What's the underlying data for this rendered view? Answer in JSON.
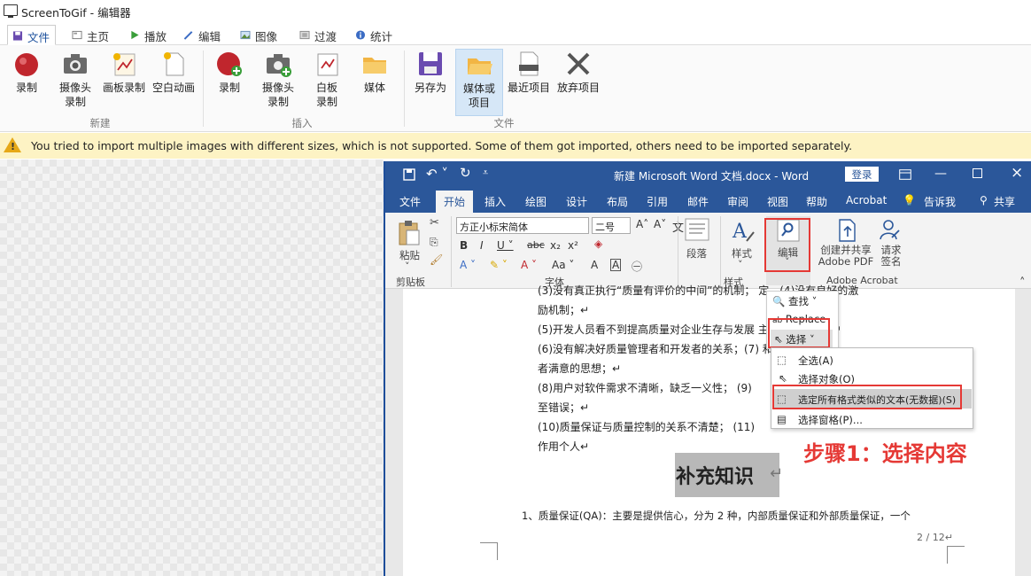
{
  "window": {
    "title": "ScreenToGif - 编辑器"
  },
  "tabs": [
    {
      "label": "文件",
      "active": true
    },
    {
      "label": "主页"
    },
    {
      "label": "播放"
    },
    {
      "label": "编辑"
    },
    {
      "label": "图像"
    },
    {
      "label": "过渡"
    },
    {
      "label": "统计"
    }
  ],
  "ribbon": {
    "new_group": {
      "label": "新建",
      "buttons": [
        {
          "label": "录制",
          "icon": "record-icon"
        },
        {
          "label": "摄像头\n录制",
          "icon": "camera-icon"
        },
        {
          "label": "画板录制",
          "icon": "board-icon"
        },
        {
          "label": "空白动画",
          "icon": "blank-page-icon"
        }
      ]
    },
    "insert_group": {
      "label": "插入",
      "buttons": [
        {
          "label": "录制",
          "icon": "record-add-icon"
        },
        {
          "label": "摄像头\n录制",
          "icon": "camera-add-icon"
        },
        {
          "label": "白板\n录制",
          "icon": "whiteboard-icon"
        },
        {
          "label": "媒体",
          "icon": "folder-icon"
        }
      ]
    },
    "file_group": {
      "label": "文件",
      "buttons": [
        {
          "label": "另存为",
          "icon": "save-icon"
        },
        {
          "label": "媒体或\n项目",
          "icon": "open-folder-icon",
          "selected": true
        },
        {
          "label": "最近项目",
          "icon": "recent-icon"
        },
        {
          "label": "放弃项目",
          "icon": "discard-icon"
        }
      ]
    }
  },
  "warning": {
    "text": "You tried to import multiple images with different sizes, which is not supported. Some of them got imported, others need to be imported separately."
  },
  "word": {
    "title": "新建 Microsoft Word 文档.docx  -  Word",
    "login_label": "登录",
    "tabs": [
      "文件",
      "开始",
      "插入",
      "绘图",
      "设计",
      "布局",
      "引用",
      "邮件",
      "审阅",
      "视图",
      "帮助",
      "Acrobat"
    ],
    "active_tab": "开始",
    "tell_me": "告诉我",
    "share": "共享",
    "ribbon": {
      "paste": "粘贴",
      "clipboard": "剪贴板",
      "font_name": "方正小标宋简体",
      "font_size": "二号",
      "font_group": "字体",
      "paragraph": "段落",
      "styles": "样式",
      "styles_group": "样式",
      "editing": "编辑",
      "create_pdf": "创建并共享\nAdobe PDF",
      "request_sign": "请求\n签名",
      "acrobat_group": "Adobe Acrobat"
    },
    "document": {
      "lines": [
        "(3)没有真正执行“质量有评价的中间”的机制；       定，(4)没有良好的激",
        "励机制；↵",
        "(5)开发人员看不到提高质量对企业生存与发展         主人翁责任感；↵",
        "(6)没有解决好质量管理者和开发者的关系；(7)         和高手会大作用",
        "者满意的思想；↵",
        "(8)用户对软件需求不清晰，缺乏一义性；     (9)",
        "至错误；↵",
        "(10)质量保证与质量控制的关系不清楚；       (11)",
        "作用个人↵"
      ],
      "heading": "补充知识",
      "para": "1、质量保证(QA)：主要是提供信心，分为 2 种，内部质量保证和外部质量保证，一个",
      "page_num": "2 / 12↵"
    },
    "find_menu": {
      "find": "查找",
      "replace": "Replace",
      "select": "选择"
    },
    "select_menu": [
      "全选(A)",
      "选择对象(O)",
      "选定所有格式类似的文本(无数据)(S)",
      "选择窗格(P)..."
    ]
  },
  "annotation": "步骤1：选择内容",
  "colors": {
    "word_blue": "#2b579a",
    "annotation_red": "#e53935",
    "warning_bg": "#fdf3c4"
  }
}
